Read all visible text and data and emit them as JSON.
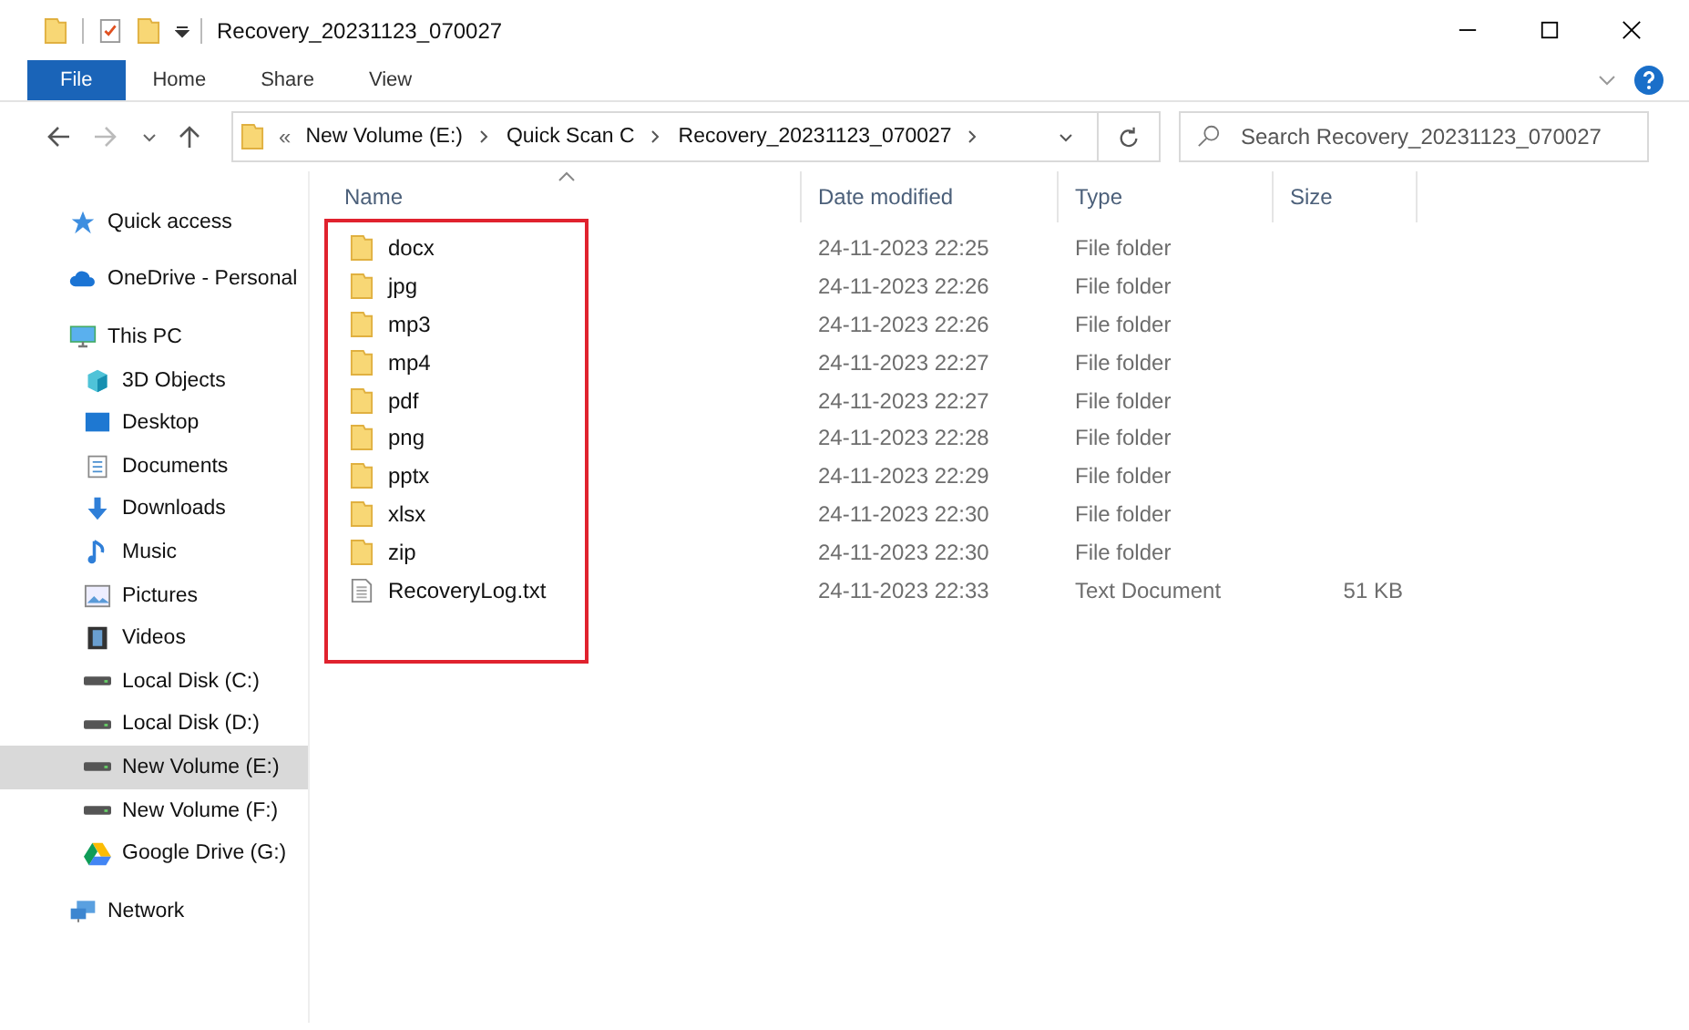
{
  "window": {
    "title": "Recovery_20231123_070027"
  },
  "ribbon": {
    "tabs": [
      {
        "label": "File",
        "selected": true
      },
      {
        "label": "Home",
        "selected": false
      },
      {
        "label": "Share",
        "selected": false
      },
      {
        "label": "View",
        "selected": false
      }
    ]
  },
  "address_bar": {
    "overflow": "«",
    "crumbs": [
      "New Volume (E:)",
      "Quick Scan C",
      "Recovery_20231123_070027"
    ]
  },
  "search": {
    "placeholder": "Search Recovery_20231123_070027"
  },
  "sidebar": {
    "items": [
      {
        "label": "Quick access",
        "kind": "star",
        "selected": false
      },
      {
        "label": "OneDrive - Personal",
        "kind": "cloud",
        "selected": false
      },
      {
        "label": "This PC",
        "kind": "pc",
        "selected": false,
        "children": [
          {
            "label": "3D Objects",
            "kind": "cube",
            "selected": false
          },
          {
            "label": "Desktop",
            "kind": "desktop",
            "selected": false
          },
          {
            "label": "Documents",
            "kind": "document",
            "selected": false
          },
          {
            "label": "Downloads",
            "kind": "download",
            "selected": false
          },
          {
            "label": "Music",
            "kind": "music",
            "selected": false
          },
          {
            "label": "Pictures",
            "kind": "pictures",
            "selected": false
          },
          {
            "label": "Videos",
            "kind": "videos",
            "selected": false
          },
          {
            "label": "Local Disk (C:)",
            "kind": "disk",
            "selected": false
          },
          {
            "label": "Local Disk (D:)",
            "kind": "disk",
            "selected": false
          },
          {
            "label": "New Volume (E:)",
            "kind": "disk",
            "selected": true
          },
          {
            "label": "New Volume (F:)",
            "kind": "disk",
            "selected": false
          },
          {
            "label": "Google Drive (G:)",
            "kind": "gdrive",
            "selected": false
          }
        ]
      },
      {
        "label": "Network",
        "kind": "network",
        "selected": false
      }
    ]
  },
  "table": {
    "columns": [
      "Name",
      "Date modified",
      "Type",
      "Size"
    ],
    "rows": [
      {
        "kind": "folder",
        "name": "docx",
        "date": "24-11-2023 22:25",
        "type": "File folder"
      },
      {
        "kind": "folder",
        "name": "jpg",
        "date": "24-11-2023 22:26",
        "type": "File folder"
      },
      {
        "kind": "folder",
        "name": "mp3",
        "date": "24-11-2023 22:26",
        "type": "File folder"
      },
      {
        "kind": "folder",
        "name": "mp4",
        "date": "24-11-2023 22:27",
        "type": "File folder"
      },
      {
        "kind": "folder",
        "name": "pdf",
        "date": "24-11-2023 22:27",
        "type": "File folder"
      },
      {
        "kind": "folder",
        "name": "png",
        "date": "24-11-2023 22:28",
        "type": "File folder"
      },
      {
        "kind": "folder",
        "name": "pptx",
        "date": "24-11-2023 22:29",
        "type": "File folder"
      },
      {
        "kind": "folder",
        "name": "xlsx",
        "date": "24-11-2023 22:30",
        "type": "File folder"
      },
      {
        "kind": "folder",
        "name": "zip",
        "date": "24-11-2023 22:30",
        "type": "File folder"
      },
      {
        "kind": "text",
        "name": "RecoveryLog.txt",
        "date": "24-11-2023 22:33",
        "type": "Text Document",
        "size": "51 KB"
      }
    ]
  }
}
